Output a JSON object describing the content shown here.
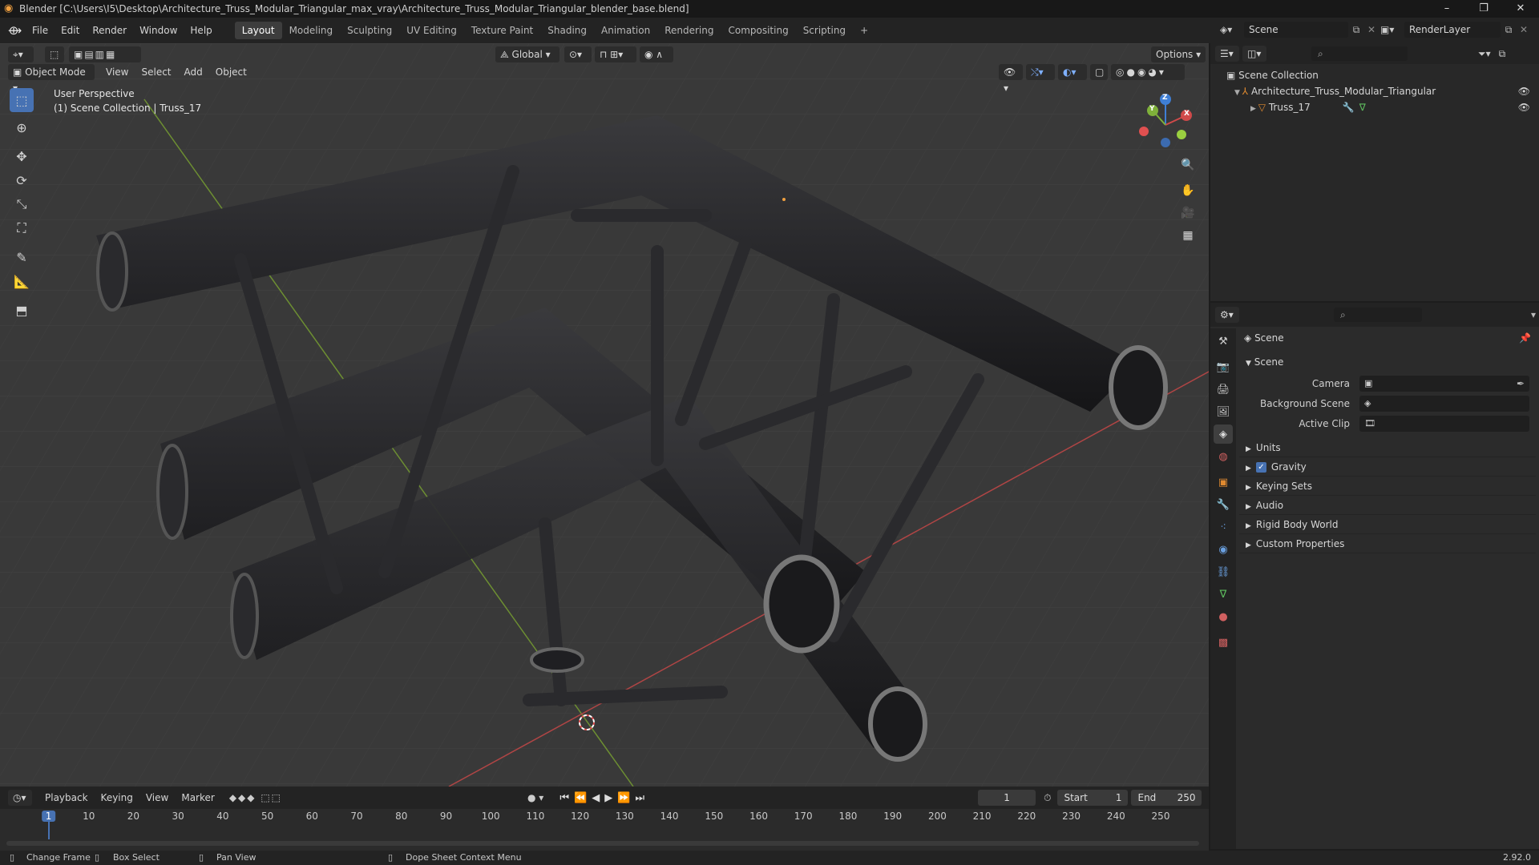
{
  "window": {
    "title": "Blender [C:\\Users\\I5\\Desktop\\Architecture_Truss_Modular_Triangular_max_vray\\Architecture_Truss_Modular_Triangular_blender_base.blend]",
    "minimize": "–",
    "maximize": "❐",
    "close": "✕"
  },
  "menu": [
    "File",
    "Edit",
    "Render",
    "Window",
    "Help"
  ],
  "workspaces": [
    "Layout",
    "Modeling",
    "Sculpting",
    "UV Editing",
    "Texture Paint",
    "Shading",
    "Animation",
    "Rendering",
    "Compositing",
    "Scripting"
  ],
  "workspace_add": "+",
  "scene_selector": {
    "scene": "Scene",
    "render_layer": "RenderLayer"
  },
  "viewport": {
    "mode": "Object Mode",
    "menus": [
      "View",
      "Select",
      "Add",
      "Object"
    ],
    "transform_orientation": "Global",
    "options": "Options",
    "overlay_title": "User Perspective",
    "overlay_subtitle": "(1) Scene Collection | Truss_17",
    "gizmo": {
      "x": "X",
      "y": "Y",
      "z": "Z"
    }
  },
  "outliner": {
    "root": "Scene Collection",
    "collection": "Architecture_Truss_Modular_Triangular",
    "object": "Truss_17"
  },
  "properties": {
    "header": "Scene",
    "section": "Scene",
    "fields": [
      {
        "label": "Camera"
      },
      {
        "label": "Background Scene"
      },
      {
        "label": "Active Clip"
      }
    ],
    "panels": [
      "Units",
      "Gravity",
      "Keying Sets",
      "Audio",
      "Rigid Body World",
      "Custom Properties"
    ],
    "gravity_checked": true
  },
  "timeline": {
    "menus": [
      "Playback",
      "Keying",
      "View",
      "Marker"
    ],
    "current_frame": "1",
    "start_label": "Start",
    "start": "1",
    "end_label": "End",
    "end": "250",
    "ticks": [
      "1",
      "10",
      "20",
      "30",
      "40",
      "50",
      "60",
      "70",
      "80",
      "90",
      "100",
      "110",
      "120",
      "130",
      "140",
      "150",
      "160",
      "170",
      "180",
      "190",
      "200",
      "210",
      "220",
      "230",
      "240",
      "250"
    ]
  },
  "status": {
    "change_frame": "Change Frame",
    "box_select": "Box Select",
    "pan_view": "Pan View",
    "context_menu": "Dope Sheet Context Menu",
    "version": "2.92.0"
  },
  "colors": {
    "accent": "#4772b3",
    "x_axis": "#d04a4a",
    "y_axis": "#7fb13a",
    "z_axis": "#3f7fd6"
  }
}
